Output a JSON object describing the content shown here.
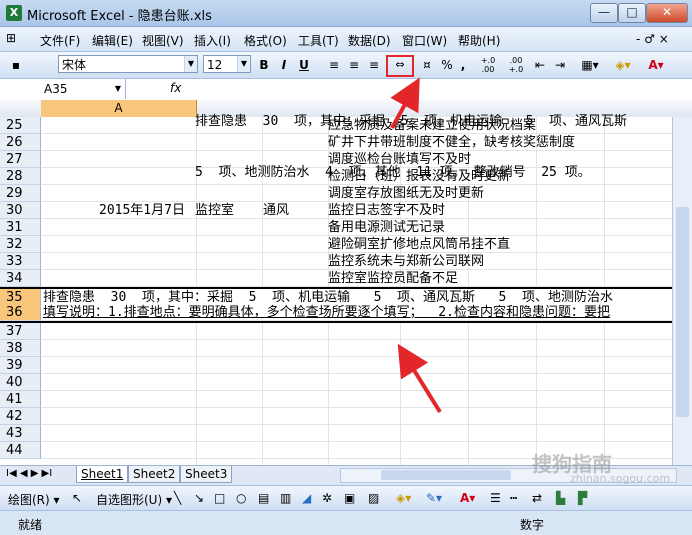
{
  "window": {
    "app_icon": "X",
    "title": "Microsoft Excel - 隐患台账.xls",
    "buttons": [
      "—",
      "□",
      "✕"
    ]
  },
  "menu": {
    "items": [
      "文件(F)",
      "编辑(E)",
      "视图(V)",
      "插入(I)",
      "格式(O)",
      "工具(T)",
      "数据(D)",
      "窗口(W)",
      "帮助(H)"
    ],
    "mdi_controls": "- ♂ ×"
  },
  "toolbar": {
    "font_name": "宋体",
    "font_size": "12",
    "bold": "B",
    "italic": "I",
    "underline": "U",
    "percent": "%",
    "comma": ",",
    "inc_decimal": "+.0 .00",
    "dec_decimal": ".00 +.0"
  },
  "formula_bar": {
    "name_box": "A35",
    "fx": "fx",
    "line1": "排查隐患  30  项，其中：采掘  5  项、机电运输   5  项、通风瓦斯",
    "line2": "5  项、地测防治水  4  项、其他  11 项。 整改销号  25 项。"
  },
  "columns": {
    "selected": "A"
  },
  "rows": [
    {
      "num": "25",
      "d": "应急物质及备案未建立使用状况档案"
    },
    {
      "num": "26",
      "d": "矿井下井带班制度不健全，缺考核奖惩制度"
    },
    {
      "num": "27",
      "d": "调度巡检台账填写不及时"
    },
    {
      "num": "28",
      "d": "检测日（班）报表没有及时更新"
    },
    {
      "num": "29",
      "d": "调度室存放图纸无及时更新"
    },
    {
      "num": "30",
      "a": "2015年1月7日",
      "b": "监控室",
      "c": "通风",
      "d": "监控日志签字不及时"
    },
    {
      "num": "31",
      "d": "备用电源测试无记录"
    },
    {
      "num": "32",
      "d": "避险硐室扩修地点风筒吊挂不直"
    },
    {
      "num": "33",
      "d": "监控系统未与郑新公司联网"
    },
    {
      "num": "34",
      "d": "监控室监控员配备不足"
    },
    {
      "num": "35",
      "wide": "排查隐患  30  项，其中：采掘  5  项、机电运输   5  项、通风瓦斯   5  项、地测防治水"
    },
    {
      "num": "36",
      "wide": "填写说明：1.排查地点：要明确具体，多个检查场所要逐个填写；  2.检查内容和隐患问题：要把"
    },
    {
      "num": "37"
    },
    {
      "num": "38"
    },
    {
      "num": "39"
    },
    {
      "num": "40"
    },
    {
      "num": "41"
    },
    {
      "num": "42"
    },
    {
      "num": "43"
    },
    {
      "num": "44"
    }
  ],
  "sheets": {
    "nav": "I◀ ◀ ▶ ▶I",
    "tabs": [
      "Sheet1",
      "Sheet2",
      "Sheet3"
    ],
    "active": "Sheet1"
  },
  "drawing_toolbar": {
    "draw": "绘图(R) ▾",
    "autoshapes": "自选图形(U) ▾"
  },
  "status": {
    "left": "就绪",
    "right": "数字"
  },
  "watermark": {
    "main": "搜狗指南",
    "sub": "zhinan.sogou.com"
  },
  "colors": {
    "accent_orange": "#f9c77c",
    "arrow_red": "#e3262a"
  }
}
